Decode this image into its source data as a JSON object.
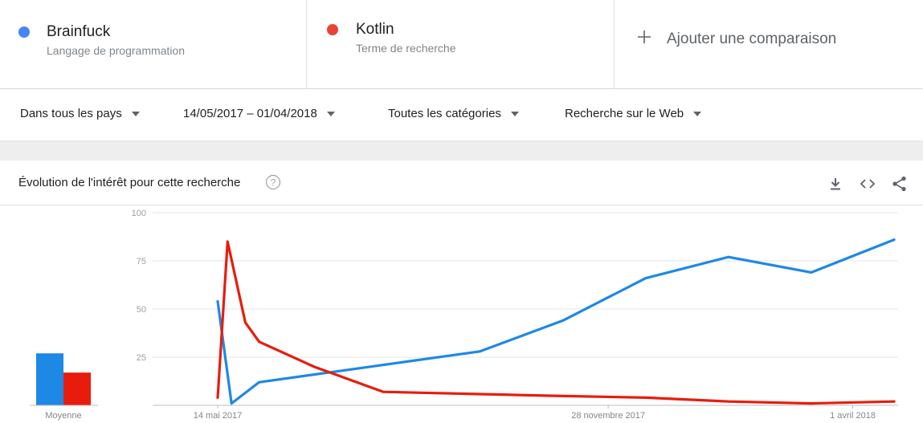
{
  "terms": [
    {
      "name": "Brainfuck",
      "subtitle": "Langage de programmation",
      "color": "#4285f4"
    },
    {
      "name": "Kotlin",
      "subtitle": "Terme de recherche",
      "color": "#ea4335"
    }
  ],
  "add_comparison": {
    "icon": "plus-icon",
    "label": "Ajouter une comparaison"
  },
  "filters": {
    "country": "Dans tous les pays",
    "date_range": "14/05/2017 – 01/04/2018",
    "category": "Toutes les catégories",
    "search_type": "Recherche sur le Web"
  },
  "chart_card": {
    "title": "Évolution de l'intérêt pour cette recherche",
    "help_icon": "help-circle-icon",
    "actions": [
      "download-icon",
      "embed-code-icon",
      "share-icon"
    ]
  },
  "chart_data": {
    "type": "line",
    "ylim": [
      0,
      100
    ],
    "y_ticks": [
      100,
      75,
      50,
      25
    ],
    "x_ticks": [
      "14 mai 2017",
      "28 novembre 2017",
      "1 avril 2018"
    ],
    "x_ticks_days": [
      0,
      198,
      322
    ],
    "x_range_days": [
      -33,
      345
    ],
    "grid": true,
    "legend": "none",
    "series": [
      {
        "color": "#1e88e5",
        "points": [
          [
            0,
            54
          ],
          [
            7,
            1
          ],
          [
            21,
            12
          ],
          [
            63,
            18
          ],
          [
            91,
            22
          ],
          [
            133,
            28
          ],
          [
            175,
            44
          ],
          [
            217,
            66
          ],
          [
            259,
            77
          ],
          [
            301,
            69
          ],
          [
            343,
            86
          ]
        ]
      },
      {
        "color": "#e81c0c",
        "points": [
          [
            0,
            4
          ],
          [
            5,
            85
          ],
          [
            14,
            43
          ],
          [
            21,
            33
          ],
          [
            49,
            20
          ],
          [
            84,
            7
          ],
          [
            168,
            5
          ],
          [
            217,
            4
          ],
          [
            259,
            2
          ],
          [
            301,
            1
          ],
          [
            343,
            2
          ]
        ]
      }
    ],
    "averages": {
      "label": "Moyenne",
      "bars": [
        {
          "value": 27,
          "color": "#1e88e5"
        },
        {
          "value": 17,
          "color": "#e81c0c"
        }
      ]
    }
  }
}
